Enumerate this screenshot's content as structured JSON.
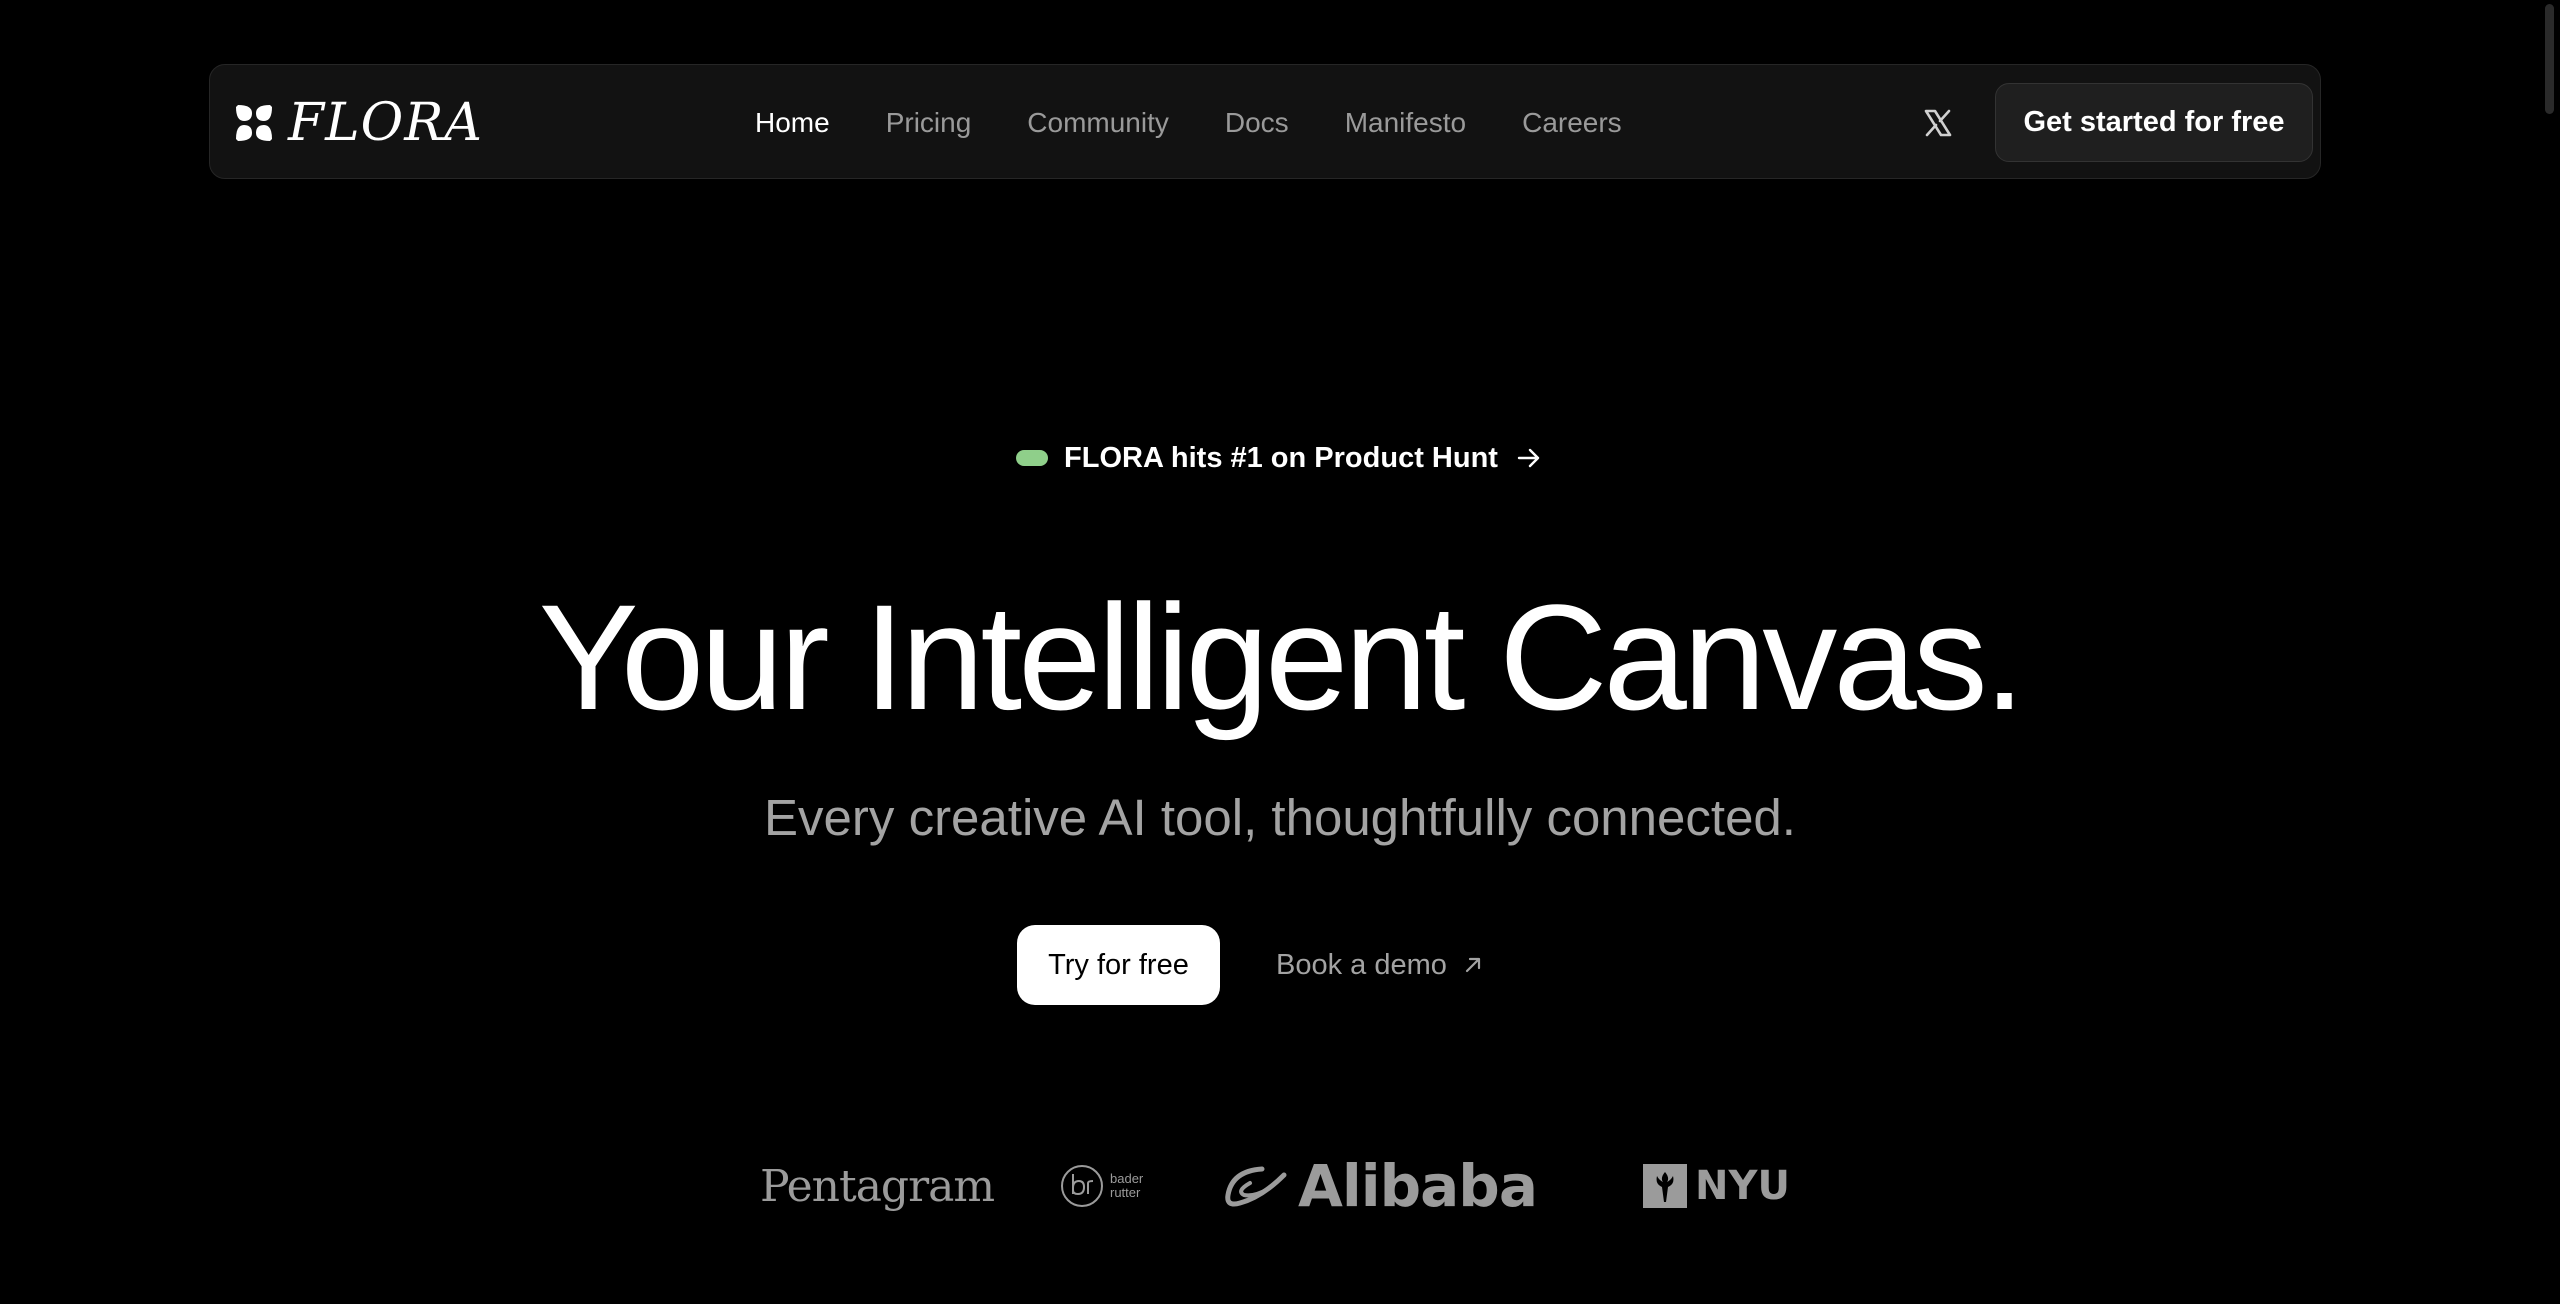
{
  "brand": {
    "name": "FLORA",
    "logo_icon": "flower-logo-icon"
  },
  "nav": {
    "items": [
      {
        "label": "Home",
        "active": true
      },
      {
        "label": "Pricing",
        "active": false
      },
      {
        "label": "Community",
        "active": false
      },
      {
        "label": "Docs",
        "active": false
      },
      {
        "label": "Manifesto",
        "active": false
      },
      {
        "label": "Careers",
        "active": false
      }
    ],
    "social_icon": "x-icon",
    "cta_label": "Get started for free"
  },
  "hero": {
    "announcement": "FLORA hits #1 on Product Hunt",
    "announcement_pill_color": "#8fcf8a",
    "headline": "Your Intelligent Canvas.",
    "subheadline": "Every creative AI tool, thoughtfully connected.",
    "primary_cta": "Try for free",
    "secondary_cta": "Book a demo"
  },
  "customers": {
    "pentagram": "Pentagram",
    "bader_rutter_line1": "bader",
    "bader_rutter_line2": "rutter",
    "alibaba": "Alibaba",
    "nyu": "NYU"
  },
  "colors": {
    "background": "#000000",
    "nav_background": "#121212",
    "muted_text": "#9a9a9a",
    "accent": "#8fcf8a"
  }
}
